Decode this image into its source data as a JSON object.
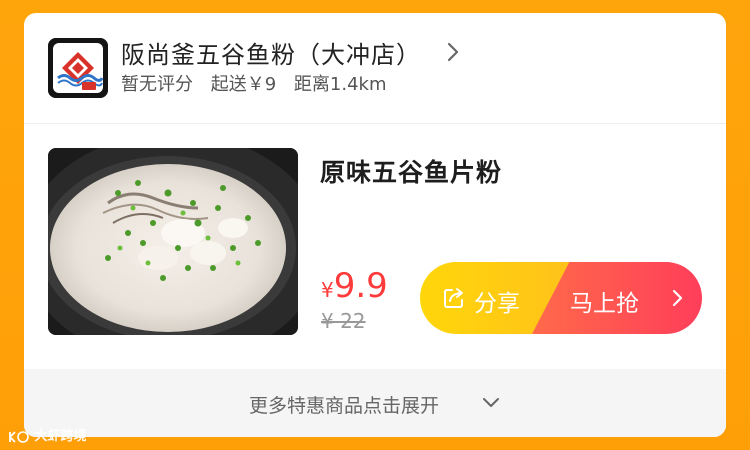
{
  "store": {
    "name": "阪尚釜五谷鱼粉（大冲店）",
    "rating": "暂无评分",
    "min_delivery": "起送￥9",
    "distance": "距离1.4km",
    "logo_icon": "fish-logo-icon"
  },
  "product": {
    "name": "原味五谷鱼片粉",
    "price_symbol": "¥",
    "price": "9.9",
    "original_price": "¥ 22",
    "image_icon": "fish-noodle-soup-photo"
  },
  "actions": {
    "share_label": "分享",
    "grab_label": "马上抢",
    "share_icon": "share-icon",
    "grab_icon": "chevron-right-icon"
  },
  "footer": {
    "expand_label": "更多特惠商品点击展开",
    "expand_icon": "chevron-down-icon"
  },
  "watermark": {
    "text": "大虾跨境"
  },
  "colors": {
    "background": "#FFA20A",
    "price_red": "#FF3B3B",
    "share_yellow": "#FFD60A",
    "grab_red": "#FF4A55"
  }
}
